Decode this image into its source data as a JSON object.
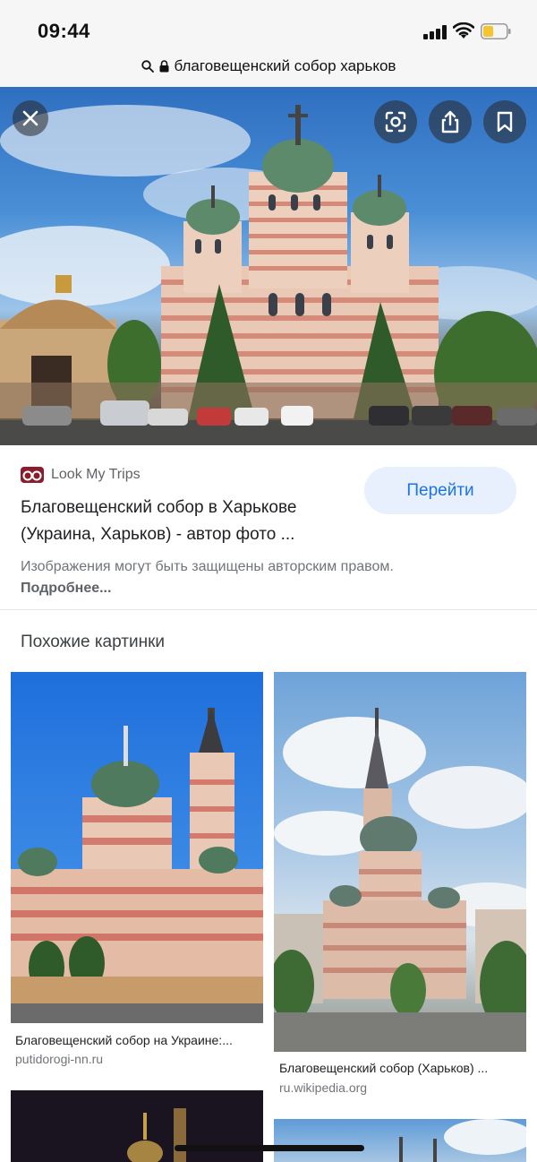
{
  "status_bar": {
    "time": "09:44"
  },
  "url_bar": {
    "query": "благовещенский собор харьков"
  },
  "result": {
    "source": "Look My Trips",
    "title": "Благовещенский собор в Харькове (Украина, Харьков) - автор фото ...",
    "go_label": "Перейти",
    "copyright_text": "Изображения могут быть защищены авторским правом.",
    "more_label": "Подробнее..."
  },
  "similar": {
    "heading": "Похожие картинки",
    "items": [
      {
        "caption": "Благовещенский собор на Украине:...",
        "source": "putidorogi-nn.ru"
      },
      {
        "caption": "Благовещенский собор (Харьков) ...",
        "source": "ru.wikipedia.org"
      }
    ]
  },
  "colors": {
    "accent": "#1a73e8",
    "button_bg": "#e8f0fe",
    "brand": "#8a1c2b"
  }
}
